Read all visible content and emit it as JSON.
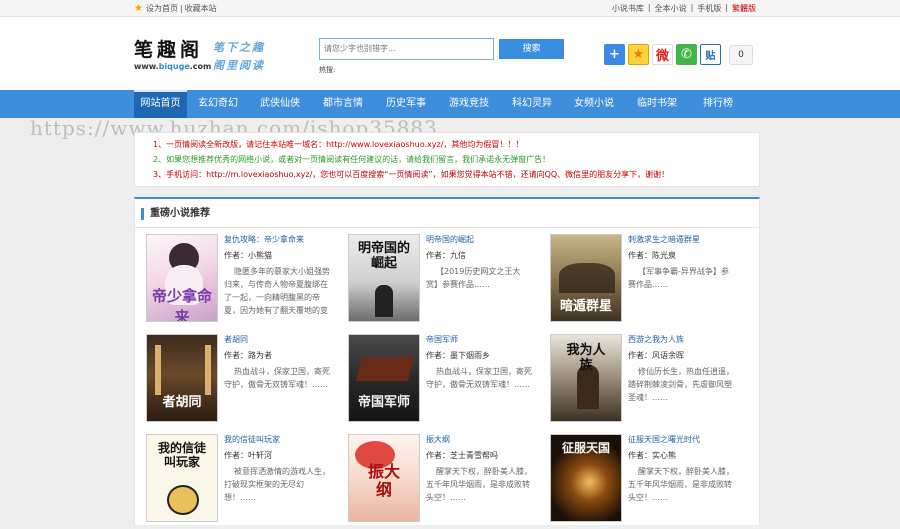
{
  "topbar": {
    "set_home": "设为首页",
    "separator": "|",
    "bookmark": "收藏本站",
    "right_links": [
      "小说书库",
      "全本小说",
      "手机版"
    ],
    "traditional": "繁體版"
  },
  "header": {
    "logo": "笔趣阁",
    "url_prefix": "www.",
    "url_accent": "biquge",
    "url_suffix": ".com",
    "slogan_1": "笔下之趣",
    "slogan_2": "阁里阅读",
    "search": {
      "placeholder": "请您少字也别错字...",
      "button": "搜索",
      "hotwords_label": "热搜:"
    },
    "share": {
      "plus": "+",
      "qzone": "★",
      "weibo": "微",
      "wechat": "✆",
      "tie": "贴",
      "count": "0"
    }
  },
  "nav": {
    "items": [
      "网站首页",
      "玄幻奇幻",
      "武侠仙侠",
      "都市言情",
      "历史军事",
      "游戏竞技",
      "科幻灵异",
      "女频小说",
      "临时书架",
      "排行榜"
    ]
  },
  "watermark": "https://www.huzhan.com/ishop35883",
  "notices": [
    "1、一页情阅读全新改版，请记住本站唯一域名：http://www.lovexiaoshuo.xyz/，其他均为假冒！！！",
    "2、如果您想推荐优秀的网络小说，或者对一页情阅读有任何建议的话，请给我们留言，我们承诺永无弹窗广告！",
    "3、手机访问：http://m.lovexiaoshuo.xyz/，您也可以百度搜索“一页情阅读”，如果您觉得本站不错，还请向QQ、微信里的朋友分享下，谢谢！"
  ],
  "recommend": {
    "title": "重磅小说推荐",
    "author_label": "作者：",
    "books": [
      {
        "title": "复仇攻略：帝少拿命来",
        "author": "小熊猫",
        "desc": "隐匿多年的慕家大小姐强势归来，与传奇人物帝夏腹绑在了一起，一向精明腹黑的帝夏，因为她有了翻天覆地的变",
        "cover_text": "帝少拿命来"
      },
      {
        "title": "明帝国的崛起",
        "author": "九信",
        "desc": "【2019历史网文之王大赏】参赛作品……",
        "cover_text": "明帝国的崛起"
      },
      {
        "title": "刺激求生之暗遁群星",
        "author": "陈光泉",
        "desc": "【军事争霸-异界战争】参赛作品……",
        "cover_text": "暗遁群星"
      },
      {
        "title": "者胡同",
        "author": "路为者",
        "desc": "热血战斗，保家卫国，寄死守护，傲骨无双铸军魂！……",
        "cover_text": "者胡同"
      },
      {
        "title": "帝国军师",
        "author": "墨下烟雨乡",
        "desc": "热血战斗，保家卫国，寄死守护，傲骨无双铸军魂！……",
        "cover_text": "帝国军师"
      },
      {
        "title": "西游之我为人族",
        "author": "风语余晖",
        "desc": "修仙历长生，热血任逍遥，踏碎荆棘凌剑骨，先虐御风塑圣魂！……",
        "cover_text": "我为人族"
      },
      {
        "title": "我的信徒叫玩家",
        "author": "叶轩河",
        "desc": "被意挥洒激情的游戏人生，打破现实框架的无尽幻想！……",
        "cover_text": "我的信徒叫玩家"
      },
      {
        "title": "振大纲",
        "author": "芝士青雪帮吗",
        "desc": "醒掌天下权，醉卧美人膝，五千年风华烟雨，是非成败转头空！……",
        "cover_text": "振大纲"
      },
      {
        "title": "征服天国之曙光时代",
        "author": "实心熊",
        "desc": "醒掌天下权，醉卧美人膝，五千年风华烟雨，是非成败转头空！……",
        "cover_text": "征服天国"
      }
    ]
  }
}
